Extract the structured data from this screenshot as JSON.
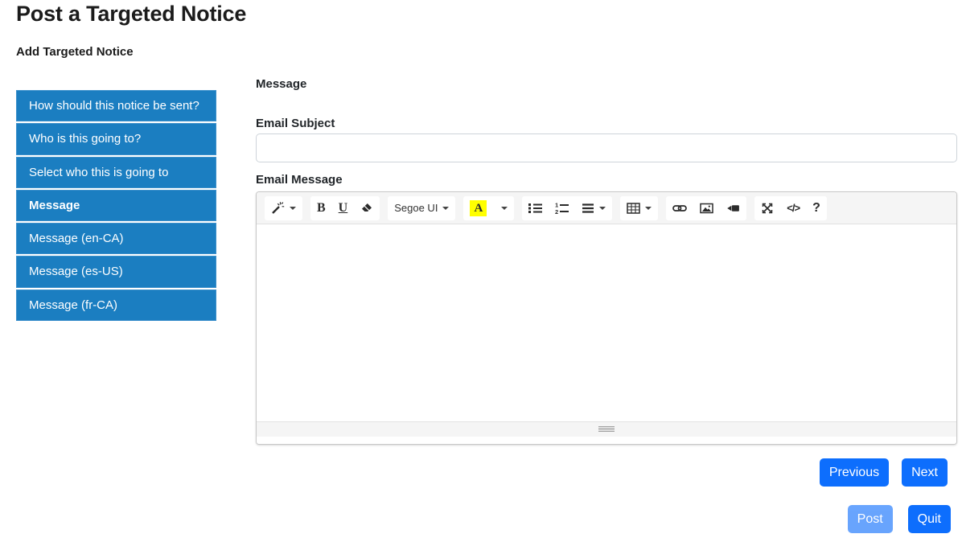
{
  "page": {
    "title": "Post a Targeted Notice",
    "subtitle": "Add Targeted Notice"
  },
  "wizard": {
    "steps": [
      {
        "label": "How should this notice be sent?",
        "active": false
      },
      {
        "label": "Who is this going to?",
        "active": false
      },
      {
        "label": "Select who this is going to",
        "active": false
      },
      {
        "label": "Message",
        "active": true
      },
      {
        "label": "Message (en-CA)",
        "active": false
      },
      {
        "label": "Message (es-US)",
        "active": false
      },
      {
        "label": "Message (fr-CA)",
        "active": false
      }
    ]
  },
  "form": {
    "section_heading": "Message",
    "email_subject_label": "Email Subject",
    "email_subject_value": "",
    "email_message_label": "Email Message",
    "email_message_value": ""
  },
  "editor_toolbar": {
    "bold": "B",
    "underline": "U",
    "font_name": "Segoe UI",
    "color_letter": "A",
    "code_view": "</>",
    "help": "?",
    "highlight_color": "#ffff00",
    "icon_names": [
      "magic-wand",
      "eraser",
      "unordered-list",
      "ordered-list",
      "paragraph-align",
      "table",
      "link",
      "picture",
      "video",
      "fullscreen",
      "code-view",
      "help"
    ]
  },
  "actions": {
    "previous": "Previous",
    "next": "Next",
    "post": "Post",
    "quit": "Quit"
  },
  "colors": {
    "step_blue": "#1b7ec1",
    "primary_button": "#0d6efd",
    "post_disabled": "#6ea8fe",
    "toolbar_bg": "#f5f5f5"
  }
}
